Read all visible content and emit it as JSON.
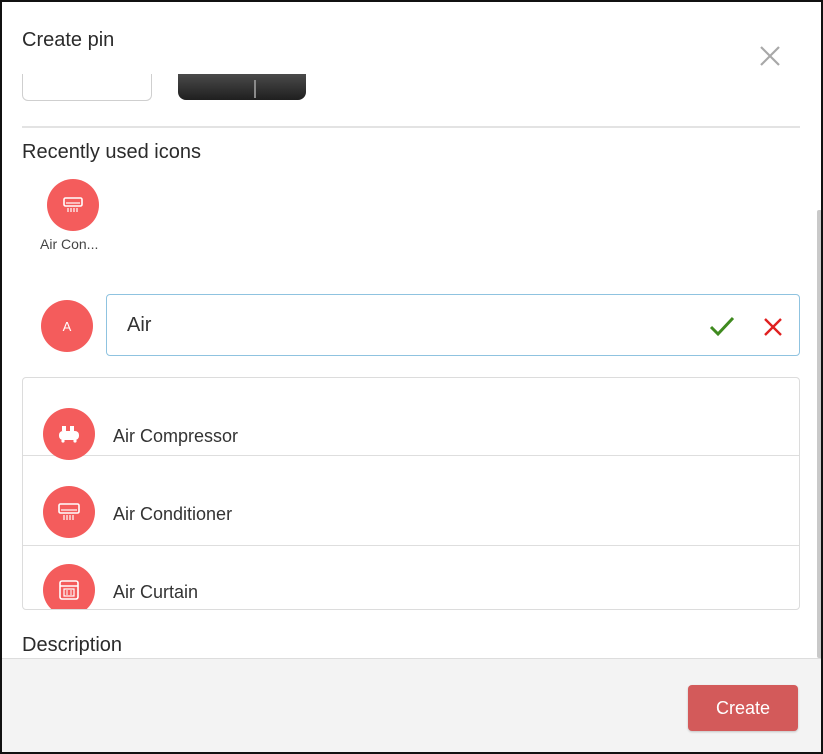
{
  "dialog": {
    "title": "Create pin"
  },
  "recent": {
    "heading": "Recently used icons",
    "items": [
      {
        "label": "Air Con...",
        "icon": "air-conditioner-icon"
      }
    ]
  },
  "picker": {
    "letter": "A",
    "search_value": "Air",
    "confirm_icon": "check-icon",
    "cancel_icon": "close-icon",
    "results": [
      {
        "label": "Air Compressor",
        "icon": "air-compressor-icon"
      },
      {
        "label": "Air Conditioner",
        "icon": "air-conditioner-icon"
      },
      {
        "label": "Air Curtain",
        "icon": "air-curtain-icon"
      }
    ]
  },
  "description": {
    "label": "Description"
  },
  "footer": {
    "create_label": "Create"
  },
  "colors": {
    "icon_bg": "#f45c5c",
    "create_button": "#d35a5a",
    "confirm": "#3f8a1f",
    "cancel": "#e02020"
  }
}
